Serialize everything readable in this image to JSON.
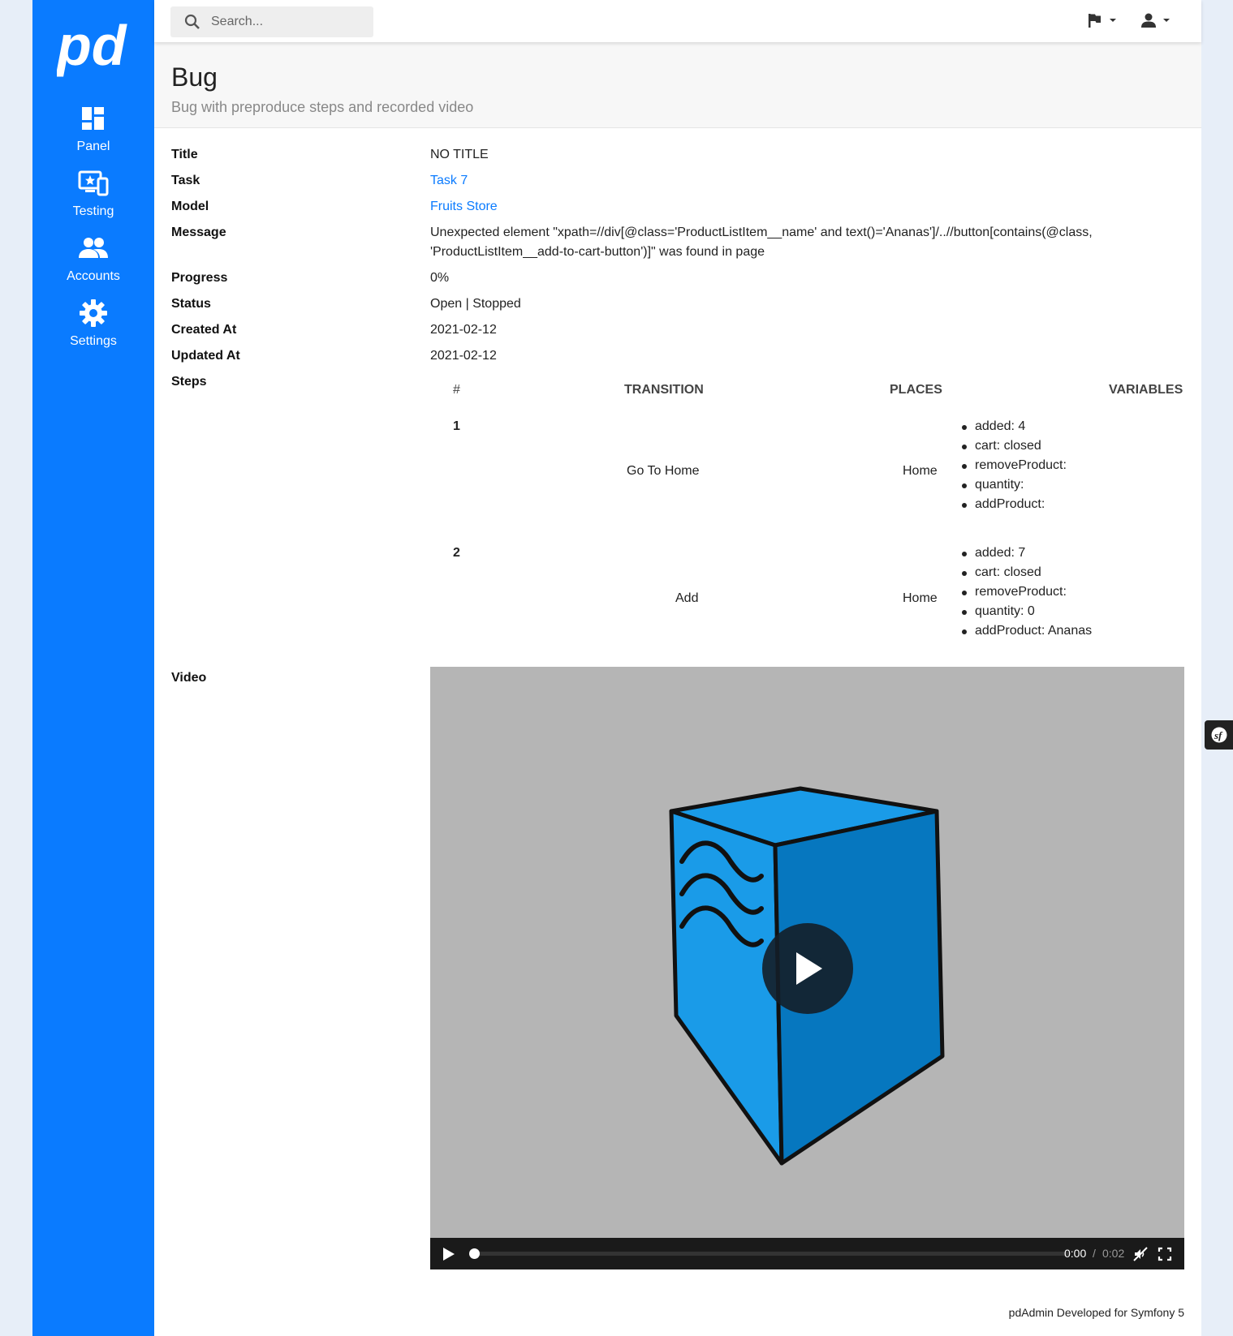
{
  "sidebar": {
    "logo": "pd",
    "items": [
      {
        "label": "Panel",
        "icon": "dashboard-icon"
      },
      {
        "label": "Testing",
        "icon": "monitor-star-icon"
      },
      {
        "label": "Accounts",
        "icon": "people-icon"
      },
      {
        "label": "Settings",
        "icon": "gear-icon"
      }
    ]
  },
  "topbar": {
    "search_placeholder": "Search...",
    "icons": [
      "search-icon",
      "flag-icon",
      "user-icon",
      "caret-down-icon"
    ]
  },
  "page": {
    "title": "Bug",
    "subtitle": "Bug with preproduce steps and recorded video"
  },
  "details": {
    "title": {
      "label": "Title",
      "value": "NO TITLE"
    },
    "task": {
      "label": "Task",
      "value": "Task 7"
    },
    "model": {
      "label": "Model",
      "value": "Fruits Store"
    },
    "message": {
      "label": "Message",
      "value": "Unexpected element \"xpath=//div[@class='ProductListItem__name' and text()='Ananas']/..//button[contains(@class, 'ProductListItem__add-to-cart-button')]\" was found in page"
    },
    "progress": {
      "label": "Progress",
      "value": "0%"
    },
    "status": {
      "label": "Status",
      "value": "Open | Stopped"
    },
    "created": {
      "label": "Created At",
      "value": "2021-02-12"
    },
    "updated": {
      "label": "Updated At",
      "value": "2021-02-12"
    },
    "steps_label": "Steps",
    "video_label": "Video"
  },
  "steps": {
    "headers": [
      "#",
      "TRANSITION",
      "PLACES",
      "VARIABLES"
    ],
    "rows": [
      {
        "num": "1",
        "transition": "Go To Home",
        "places": "Home",
        "variables": [
          "added: 4",
          "cart: closed",
          "removeProduct:",
          "quantity:",
          "addProduct:"
        ]
      },
      {
        "num": "2",
        "transition": "Add",
        "places": "Home",
        "variables": [
          "added: 7",
          "cart: closed",
          "removeProduct:",
          "quantity: 0",
          "addProduct: Ananas"
        ]
      }
    ]
  },
  "video": {
    "time_current": "0:00",
    "time_separator": "/",
    "time_duration": "0:02",
    "progress": 0
  },
  "footer": "pdAdmin Developed for Symfony 5",
  "colors": {
    "sidebar": "#0a7bff",
    "link": "#0a7bff",
    "box_front": "#1a9be8",
    "box_side": "#0677bf"
  }
}
